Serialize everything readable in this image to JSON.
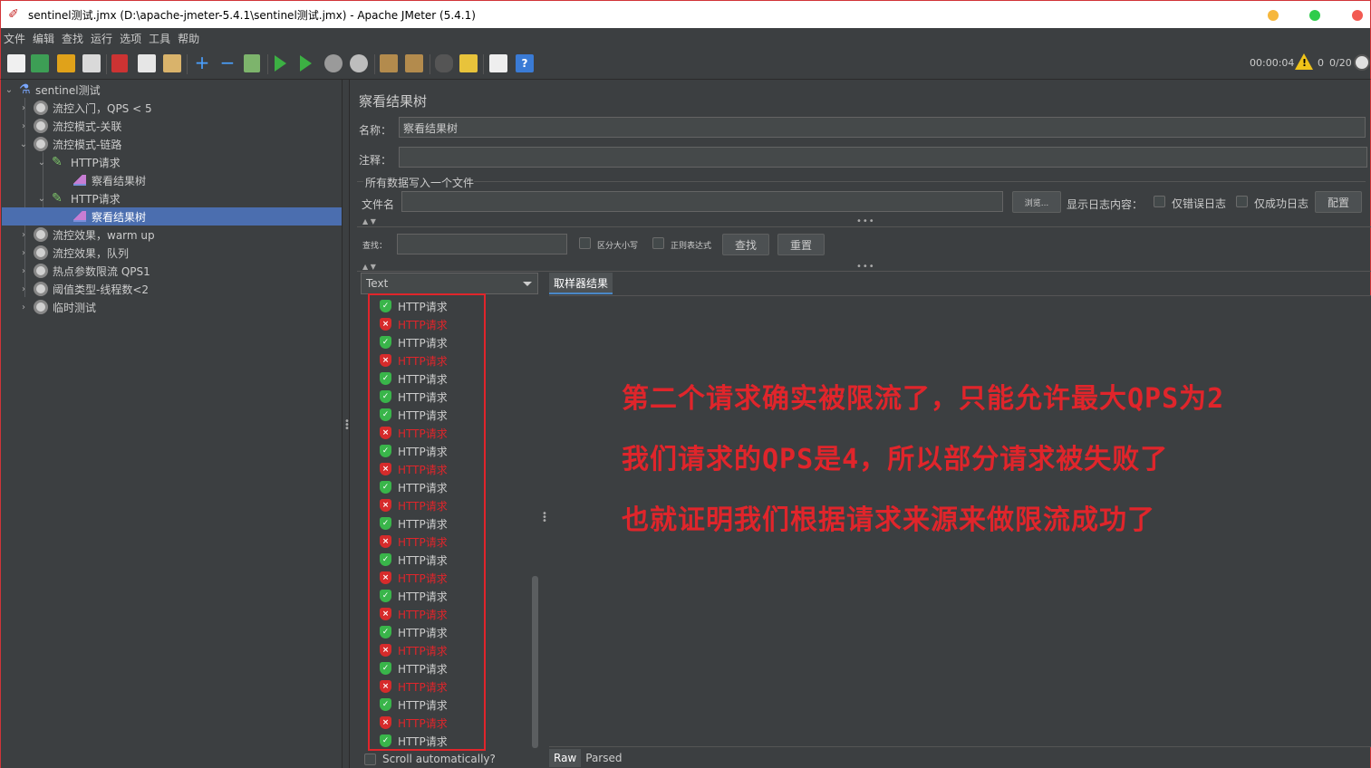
{
  "window": {
    "title": "sentinel测试.jmx (D:\\apache-jmeter-5.4.1\\sentinel测试.jmx) - Apache JMeter (5.4.1)"
  },
  "menu": [
    "文件",
    "编辑",
    "查找",
    "运行",
    "选项",
    "工具",
    "帮助"
  ],
  "toolbar": {
    "timer": "00:00:04",
    "warnings": "0",
    "threads": "0/20"
  },
  "tree": {
    "root": "sentinel测试",
    "items": [
      "流控入门，QPS < 5",
      "流控模式-关联",
      "流控模式-链路",
      "HTTP请求",
      "察看结果树",
      "HTTP请求",
      "察看结果树",
      "流控效果，warm up",
      "流控效果，队列",
      "热点参数限流 QPS1",
      "阈值类型-线程数<2",
      "临时测试"
    ]
  },
  "panel": {
    "title": "察看结果树",
    "name_label": "名称：",
    "name_value": "察看结果树",
    "comment_label": "注释：",
    "file_section": "所有数据写入一个文件",
    "filename_label": "文件名",
    "browse": "浏览...",
    "log_label": "显示日志内容：",
    "errors_only": "仅错误日志",
    "success_only": "仅成功日志",
    "config": "配置",
    "search_label": "查找：",
    "case_sensitive": "区分大小写",
    "regex": "正则表达式",
    "find_btn": "查找",
    "reset_btn": "重置",
    "renderer": "Text",
    "scroll_auto": "Scroll automatically?",
    "tab_sampler": "取样器结果",
    "tab_raw": "Raw",
    "tab_parsed": "Parsed"
  },
  "results": [
    {
      "label": "HTTP请求",
      "status": "ok"
    },
    {
      "label": "HTTP请求",
      "status": "err"
    },
    {
      "label": "HTTP请求",
      "status": "ok"
    },
    {
      "label": "HTTP请求",
      "status": "err"
    },
    {
      "label": "HTTP请求",
      "status": "ok"
    },
    {
      "label": "HTTP请求",
      "status": "ok"
    },
    {
      "label": "HTTP请求",
      "status": "ok"
    },
    {
      "label": "HTTP请求",
      "status": "err"
    },
    {
      "label": "HTTP请求",
      "status": "ok"
    },
    {
      "label": "HTTP请求",
      "status": "err"
    },
    {
      "label": "HTTP请求",
      "status": "ok"
    },
    {
      "label": "HTTP请求",
      "status": "err"
    },
    {
      "label": "HTTP请求",
      "status": "ok"
    },
    {
      "label": "HTTP请求",
      "status": "err"
    },
    {
      "label": "HTTP请求",
      "status": "ok"
    },
    {
      "label": "HTTP请求",
      "status": "err"
    },
    {
      "label": "HTTP请求",
      "status": "ok"
    },
    {
      "label": "HTTP请求",
      "status": "err"
    },
    {
      "label": "HTTP请求",
      "status": "ok"
    },
    {
      "label": "HTTP请求",
      "status": "err"
    },
    {
      "label": "HTTP请求",
      "status": "ok"
    },
    {
      "label": "HTTP请求",
      "status": "err"
    },
    {
      "label": "HTTP请求",
      "status": "ok"
    },
    {
      "label": "HTTP请求",
      "status": "err"
    },
    {
      "label": "HTTP请求",
      "status": "ok"
    }
  ],
  "annotations": [
    "第二个请求确实被限流了，只能允许最大QPS为2",
    "我们请求的QPS是4，所以部分请求被失败了",
    "也就证明我们根据请求来源来做限流成功了"
  ]
}
